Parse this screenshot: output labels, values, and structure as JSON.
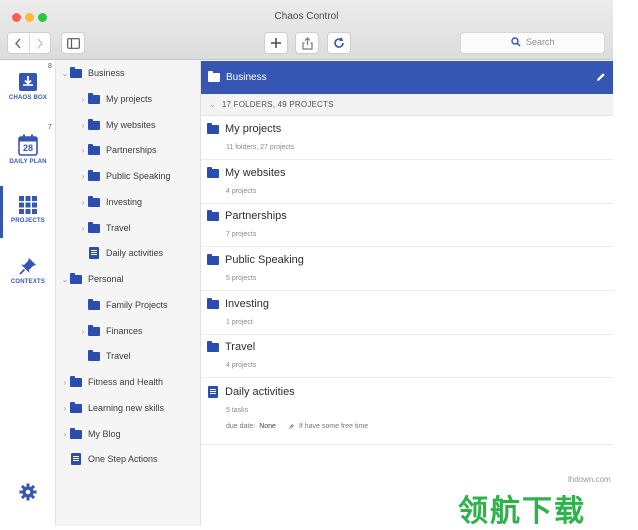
{
  "window": {
    "title": "Chaos Control"
  },
  "toolbar": {
    "search_placeholder": "Search"
  },
  "rail": {
    "items": [
      {
        "label": "CHAOS BOX",
        "icon": "inbox-icon",
        "badge": "8"
      },
      {
        "label": "DAILY PLAN",
        "icon": "calendar-icon",
        "day": "28",
        "badge": "7"
      },
      {
        "label": "PROJECTS",
        "icon": "grid-icon"
      },
      {
        "label": "CONTEXTS",
        "icon": "pin-icon"
      }
    ]
  },
  "tree": {
    "items": [
      {
        "label": "Business",
        "type": "folder",
        "chevron": "open"
      },
      {
        "label": "My projects",
        "type": "folder",
        "chevron": "closed"
      },
      {
        "label": "My websites",
        "type": "folder",
        "chevron": "closed"
      },
      {
        "label": "Partnerships",
        "type": "folder",
        "chevron": "closed"
      },
      {
        "label": "Public Speaking",
        "type": "folder",
        "chevron": "closed"
      },
      {
        "label": "Investing",
        "type": "folder",
        "chevron": "closed"
      },
      {
        "label": "Travel",
        "type": "folder",
        "chevron": "closed"
      },
      {
        "label": "Daily activities",
        "type": "doc",
        "chevron": ""
      },
      {
        "label": "Personal",
        "type": "folder",
        "chevron": "open"
      },
      {
        "label": "Family Projects",
        "type": "folder",
        "chevron": ""
      },
      {
        "label": "Finances",
        "type": "folder",
        "chevron": "closed"
      },
      {
        "label": "Travel",
        "type": "folder",
        "chevron": ""
      },
      {
        "label": "Fitness and Health",
        "type": "folder",
        "chevron": "closed"
      },
      {
        "label": "Learning new skills",
        "type": "folder",
        "chevron": "closed"
      },
      {
        "label": "My Blog",
        "type": "folder",
        "chevron": "closed"
      },
      {
        "label": "One Step Actions",
        "type": "doc",
        "chevron": ""
      }
    ]
  },
  "main": {
    "header_title": "Business",
    "summary": "17 FOLDERS, 49 PROJECTS",
    "projects": [
      {
        "title": "My projects",
        "subtitle": "11 folders, 27 projects",
        "type": "folder"
      },
      {
        "title": "My websites",
        "subtitle": "4 projects",
        "type": "folder"
      },
      {
        "title": "Partnerships",
        "subtitle": "7 projects",
        "type": "folder"
      },
      {
        "title": "Public Speaking",
        "subtitle": "5 projects",
        "type": "folder"
      },
      {
        "title": "Investing",
        "subtitle": "1 project",
        "type": "folder"
      },
      {
        "title": "Travel",
        "subtitle": "4 projects",
        "type": "folder"
      },
      {
        "title": "Daily activities",
        "subtitle": "5 tasks",
        "type": "doc",
        "due_label": "due date:",
        "due_value": "None",
        "context": "If have some free time"
      }
    ]
  },
  "watermark": {
    "site": "lhdown.com",
    "logo": "领航下载"
  },
  "colors": {
    "accent": "#3656b4",
    "folder": "#2c4db0"
  }
}
